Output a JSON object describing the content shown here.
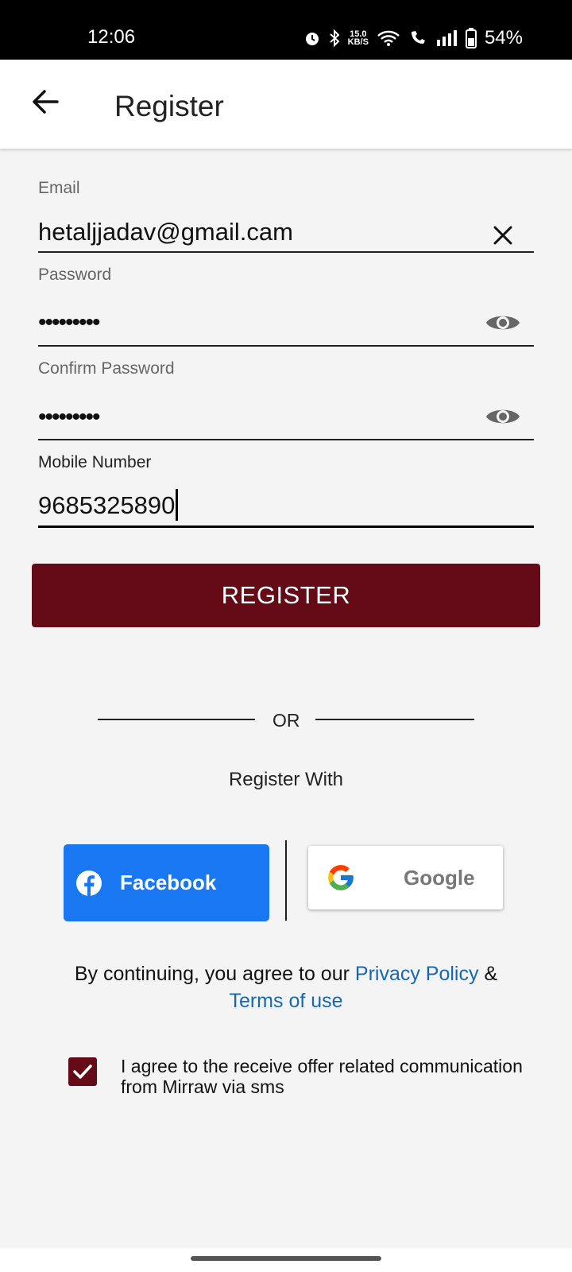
{
  "status_bar": {
    "time": "12:06",
    "net_speed_value": "15.0",
    "net_speed_unit": "KB/S",
    "battery": "54%"
  },
  "app_bar": {
    "title": "Register"
  },
  "form": {
    "email": {
      "label": "Email",
      "value": "hetaljjadav@gmail.cam"
    },
    "password": {
      "label": "Password",
      "masked_value": "•••••••••"
    },
    "confirm_password": {
      "label": "Confirm Password",
      "masked_value": "•••••••••"
    },
    "mobile": {
      "label": "Mobile Number",
      "value": "9685325890"
    }
  },
  "register_button": "REGISTER",
  "or_text": "OR",
  "register_with": "Register With",
  "social": {
    "facebook_label": "Facebook",
    "google_label": "Google"
  },
  "legal": {
    "prefix": "By continuing, you agree to our",
    "privacy_link": "Privacy Policy",
    "ampersand": "&",
    "terms_link": "Terms of use"
  },
  "consent": {
    "checked": true,
    "text": "I agree to the receive offer related communication from Mirraw via sms"
  },
  "colors": {
    "primary": "#650a17",
    "facebook": "#1977f2",
    "link": "#1668b4"
  }
}
